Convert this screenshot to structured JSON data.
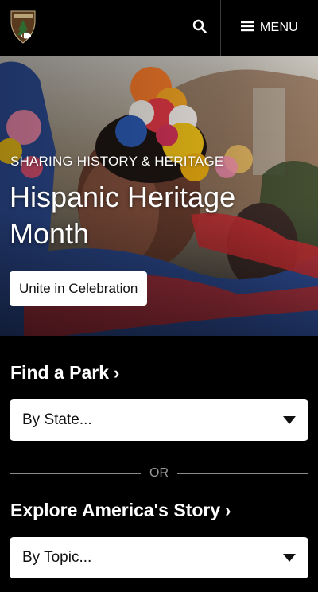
{
  "header": {
    "logo_name": "nps-arrowhead-logo",
    "search_icon": "search-icon",
    "menu_icon": "hamburger-icon",
    "menu_label": "MENU"
  },
  "hero": {
    "eyebrow": "SHARING HISTORY & HERITAGE",
    "title": "Hispanic Heritage Month",
    "cta_label": "Unite in Celebration"
  },
  "find_park": {
    "title": "Find a Park",
    "chevron": "›",
    "select_value": "By State..."
  },
  "separator": {
    "label": "OR"
  },
  "explore": {
    "title": "Explore America's Story",
    "chevron": "›",
    "select_value": "By Topic..."
  },
  "colors": {
    "background": "#000000",
    "text": "#ffffff",
    "control_bg": "#ffffff",
    "accent_red": "#c62f33",
    "accent_blue": "#2f4f9a"
  }
}
